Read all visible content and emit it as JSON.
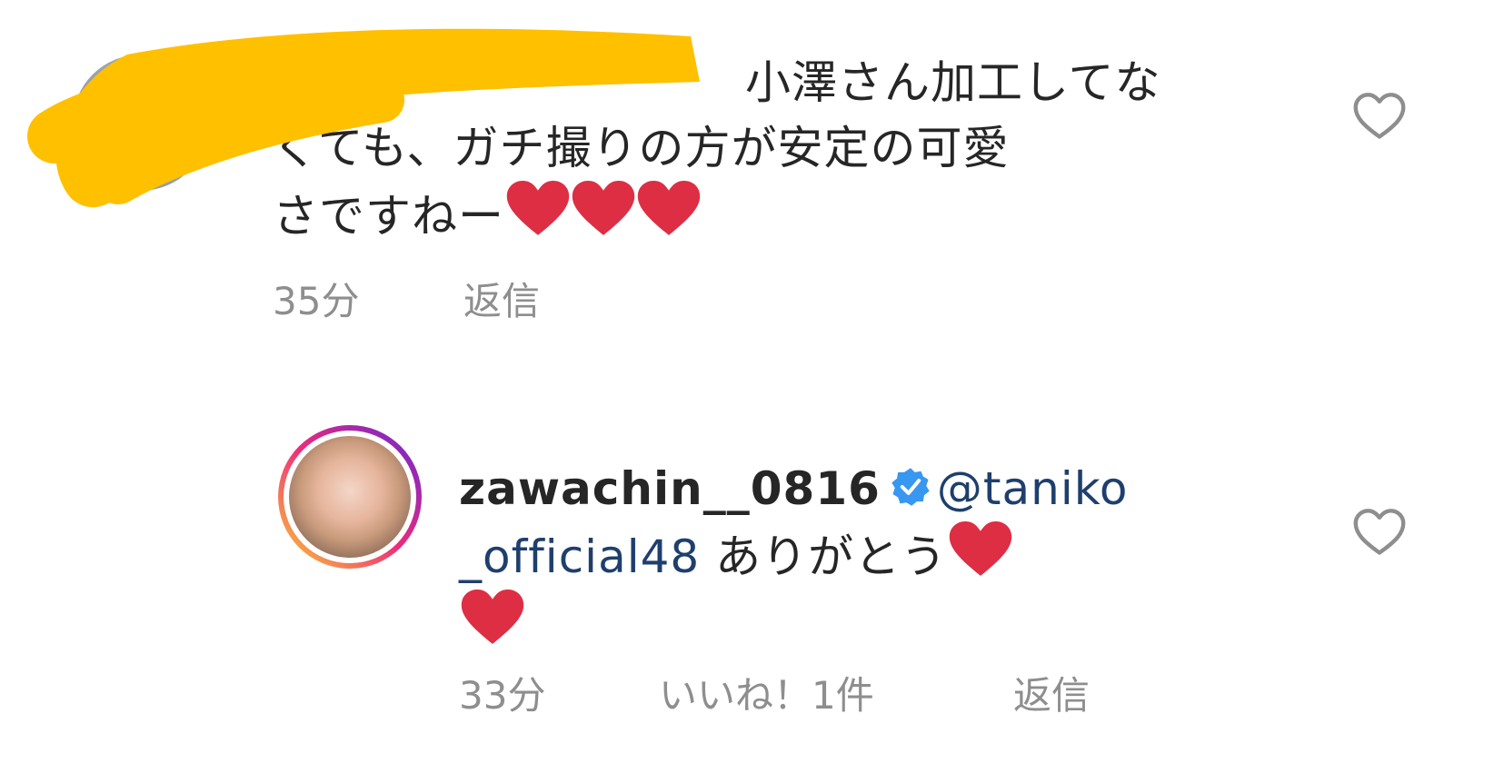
{
  "comment1": {
    "text_line1": "小澤さん加工してな",
    "text_line2": "くても、ガチ撮りの方が安定の可愛",
    "text_line3": "さですねー",
    "time": "35分",
    "reply_label": "返信"
  },
  "comment2": {
    "username": "zawachin__0816",
    "mention_part1": "@taniko",
    "mention_part2": "_official48",
    "text": "ありがとう",
    "time": "33分",
    "likes_label": "いいね！1件",
    "reply_label": "返信"
  },
  "icons": {
    "like": "heart-outline-icon",
    "emoji": "red-heart-emoji",
    "verified": "verified-badge-icon"
  },
  "colors": {
    "text": "#262626",
    "meta": "#8e8e8e",
    "mention": "#1f3f6d",
    "verified": "#3897f0",
    "heart": "#dd2e44",
    "redaction": "#ffc000"
  }
}
